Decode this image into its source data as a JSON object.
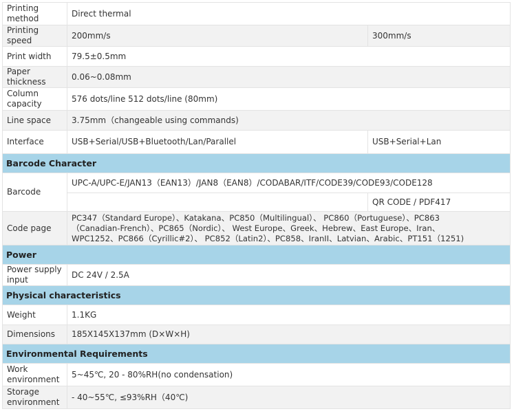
{
  "rows": {
    "printing_method": {
      "label": "Printing method",
      "value": "Direct thermal"
    },
    "printing_speed": {
      "label": "Printing speed",
      "value": "200mm/s",
      "value2": "300mm/s"
    },
    "print_width": {
      "label": "Print width",
      "value": "79.5±0.5mm"
    },
    "paper_thickness": {
      "label": "Paper thickness",
      "value": "0.06~0.08mm"
    },
    "column_capacity": {
      "label": "Column capacity",
      "value": "576 dots/line 512 dots/line (80mm)"
    },
    "line_space": {
      "label": "Line space",
      "value": "3.75mm（changeable using commands)"
    },
    "interface": {
      "label": "Interface",
      "value": "USB+Serial/USB+Bluetooth/Lan/Parallel",
      "value2": "USB+Serial+Lan"
    }
  },
  "sections": {
    "barcode_character": "Barcode Character",
    "power": "Power",
    "physical": "Physical characteristics",
    "environmental": "Environmental Requirements"
  },
  "barcode": {
    "label": "Barcode",
    "value_1d": "UPC-A/UPC-E/JAN13（EAN13）/JAN8（EAN8）/CODABAR/ITF/CODE39/CODE93/CODE128",
    "value_2d": "QR CODE / PDF417"
  },
  "code_page": {
    "label": "Code page",
    "line1": "PC347（Standard Europe）、Katakana、PC850（Multilingual）、 PC860（Portuguese）、PC863",
    "line2": "（Canadian-French）、PC865（Nordic）、 West Europe、Greek、Hebrew、East Europe、Iran、",
    "line3": "WPC1252、PC866（Cyrillic#2）、 PC852（Latin2）、PC858、IranII、Latvian、Arabic、PT151（1251)"
  },
  "power": {
    "supply": {
      "label": "Power supply input",
      "value": "DC 24V / 2.5A"
    }
  },
  "physical": {
    "weight": {
      "label": "Weight",
      "value": "1.1KG"
    },
    "dimensions": {
      "label": "Dimensions",
      "value": "185X145X137mm (D×W×H)"
    }
  },
  "environment": {
    "work": {
      "label": "Work environment",
      "value": "5~45℃, 20 - 80%RH(no condensation)"
    },
    "storage": {
      "label": "Storage environment",
      "value": "- 40~55℃, ≤93%RH（40℃)"
    }
  }
}
